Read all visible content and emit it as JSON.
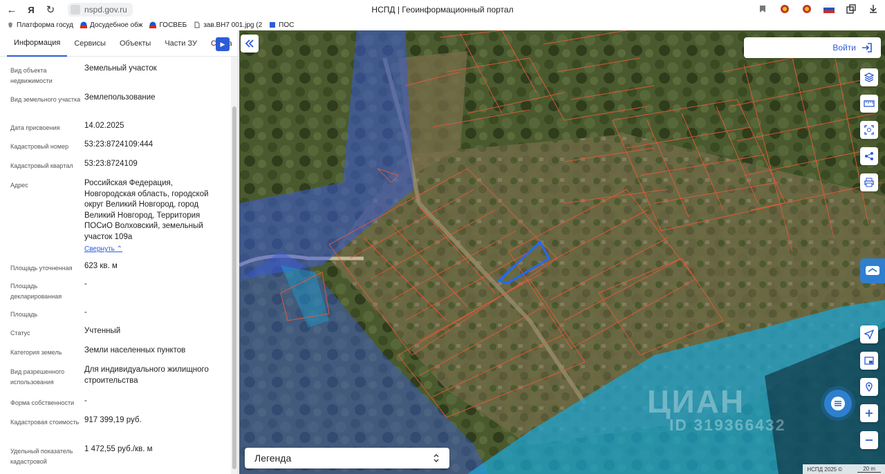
{
  "browser": {
    "url": "nspd.gov.ru",
    "title": "НСПД | Геоинформационный портал",
    "bookmarks": [
      {
        "label": "Платформа госуд",
        "icon": "emblem-icon"
      },
      {
        "label": "Досудебное обж",
        "icon": "flag-icon"
      },
      {
        "label": "ГОСВЕБ",
        "icon": "flag-icon"
      },
      {
        "label": "зав.ВН7 001.jpg (2",
        "icon": "file-icon"
      },
      {
        "label": "ПОС",
        "icon": "image-icon"
      }
    ]
  },
  "panel": {
    "tabs": [
      {
        "label": "Информация",
        "active": true
      },
      {
        "label": "Сервисы",
        "active": false
      },
      {
        "label": "Объекты",
        "active": false
      },
      {
        "label": "Части ЗУ",
        "active": false
      },
      {
        "label": "Соста",
        "active": false
      }
    ],
    "collapse_link": "Свернуть",
    "attributes": [
      {
        "label": "Вид объекта недвижимости",
        "value": "Земельный участок"
      },
      {
        "label": "Вид земельного участка",
        "value": "Землепользование"
      },
      {
        "label": "Дата присвоения",
        "value": "14.02.2025"
      },
      {
        "label": "Кадастровый номер",
        "value": "53:23:8724109:444"
      },
      {
        "label": "Кадастровый квартал",
        "value": "53:23:8724109"
      },
      {
        "label": "Адрес",
        "value": "Российская Федерация, Новгородская область, городской округ Великий Новгород, город Великий Новгород, Территория ПОСиО Волховский, земельный участок 109а"
      },
      {
        "label": "Площадь уточненная",
        "value": "623 кв. м"
      },
      {
        "label": "Площадь декларированная",
        "value": "-"
      },
      {
        "label": "Площадь",
        "value": "-"
      },
      {
        "label": "Статус",
        "value": "Учтенный"
      },
      {
        "label": "Категория земель",
        "value": "Земли населенных пунктов"
      },
      {
        "label": "Вид разрешенного использования",
        "value": "Для индивидуального жилищного строительства"
      },
      {
        "label": "Форма собственности",
        "value": "-"
      },
      {
        "label": "Кадастровая стоимость",
        "value": "917 399,19 руб."
      },
      {
        "label": "Удельный показатель кадастровой",
        "value": "1 472,55 руб./кв. м"
      }
    ]
  },
  "map": {
    "login_label": "Войти",
    "legend_label": "Легенда",
    "scale_left": "НСПД 2025 ©",
    "scale_right": "20 m",
    "watermark_logo": "ЦИАН",
    "watermark_id": "ID 319366432",
    "colors": {
      "accent": "#2d5bd8",
      "parcel_line": "#e8593a",
      "selected": "#1e6bff",
      "water": "#1aa6d6",
      "zone": "#3a5bd9"
    }
  }
}
